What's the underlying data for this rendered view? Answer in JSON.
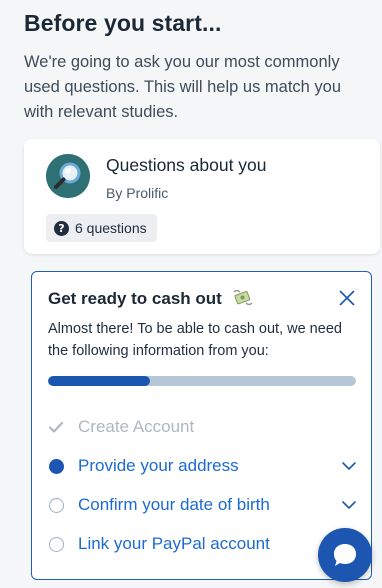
{
  "page": {
    "heading": "Before you start...",
    "intro": "We're going to ask you our most commonly used questions. This will help us match you with relevant studies."
  },
  "card": {
    "title": "Questions about you",
    "subtitle": "By Prolific",
    "chip": "6 questions",
    "avatar_icon": "magnifier-icon"
  },
  "cashout": {
    "title": "Get ready to cash out",
    "title_icon": "money-with-wings-icon",
    "description": "Almost there! To be able to cash out, we need the following information from you:",
    "progress_fraction": 0.33,
    "steps": [
      {
        "label": "Create Account",
        "state": "done"
      },
      {
        "label": "Provide your address",
        "state": "active"
      },
      {
        "label": "Confirm your date of birth",
        "state": "todo"
      },
      {
        "label": "Link your PayPal account",
        "state": "todo"
      }
    ]
  },
  "colors": {
    "accent": "#1d56b0",
    "link": "#1d6ad0",
    "muted": "#aeb8c2"
  }
}
